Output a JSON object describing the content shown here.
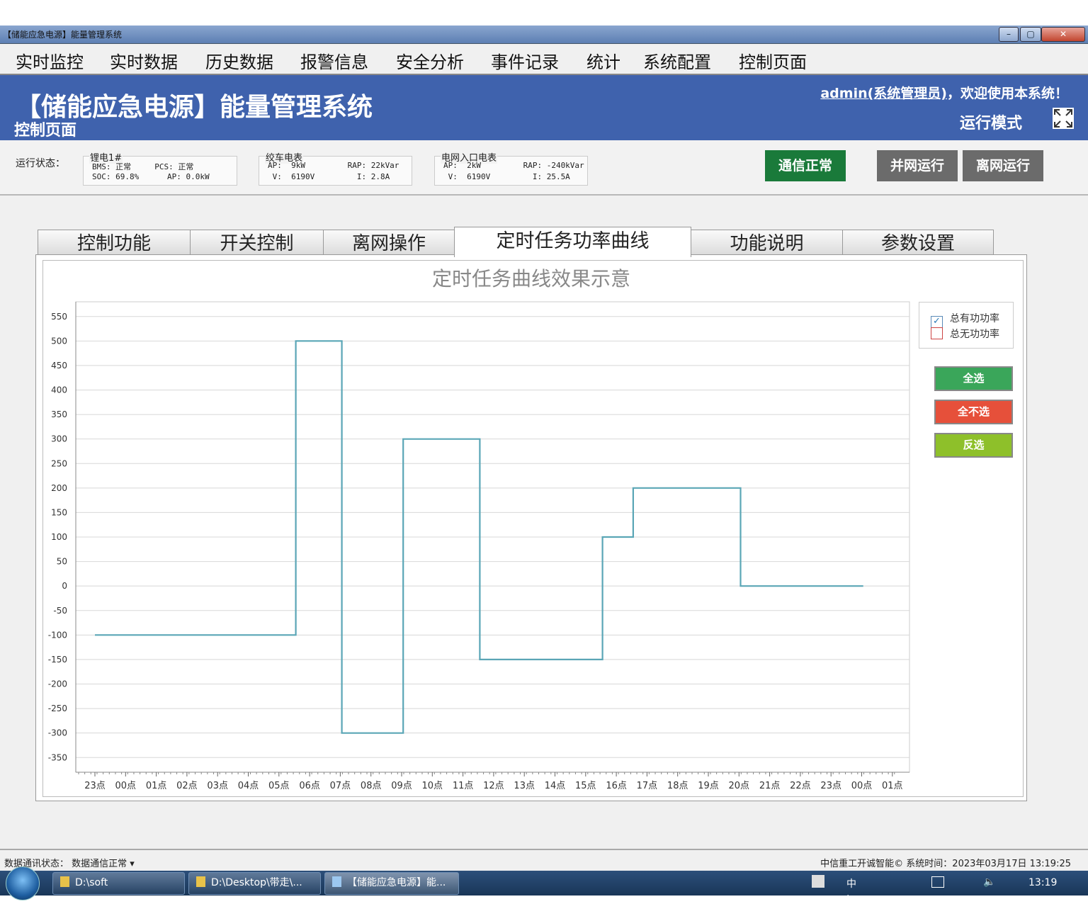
{
  "window": {
    "title": "【储能应急电源】能量管理系统"
  },
  "menu": [
    "实时监控",
    "实时数据",
    "历史数据",
    "报警信息",
    "安全分析",
    "事件记录",
    "统计",
    "系统配置",
    "控制页面"
  ],
  "header": {
    "title": "【储能应急电源】能量管理系统",
    "subtitle": "控制页面",
    "user": "admin(系统管理员)",
    "welcome_suffix": "，欢迎使用本系统！",
    "mode": "运行模式"
  },
  "status": {
    "label": "运行状态：",
    "meters": [
      {
        "title": "锂电1#",
        "line1": "BMS: 正常     PCS: 正常",
        "line2": "SOC: 69.8%      AP: 0.0kW"
      },
      {
        "title": "绞车电表",
        "line1": "AP:  9kW         RAP: 22kVar",
        "line2": " V:  6190V         I: 2.8A"
      },
      {
        "title": "电网入口电表",
        "line1": "AP:  2kW         RAP: -240kVar",
        "line2": " V:  6190V         I: 25.5A"
      }
    ],
    "comm_button": "通信正常",
    "grid_button": "并网运行",
    "offgrid_button": "离网运行"
  },
  "tabs": [
    "控制功能",
    "开关控制",
    "离网操作",
    "定时任务功率曲线",
    "功能说明",
    "参数设置"
  ],
  "active_tab": "定时任务功率曲线",
  "legend": {
    "items": [
      "总有功功率",
      "总无功功率"
    ]
  },
  "side_buttons": {
    "select_all": "全选",
    "select_none": "全不选",
    "invert": "反选"
  },
  "colors": {
    "line": "#5aa6b6",
    "select_all": "#3aa65a",
    "select_none": "#e6503a",
    "invert": "#8ec02a",
    "comm": "#1a7a3a",
    "header": "#3f62ad"
  },
  "chart_data": {
    "type": "line",
    "title": "定时任务曲线效果示意",
    "step": true,
    "x_ticks": [
      "23点",
      "00点",
      "01点",
      "02点",
      "03点",
      "04点",
      "05点",
      "06点",
      "07点",
      "08点",
      "09点",
      "10点",
      "11点",
      "12点",
      "13点",
      "14点",
      "15点",
      "16点",
      "17点",
      "18点",
      "19点",
      "20点",
      "21点",
      "22点",
      "23点",
      "00点",
      "01点"
    ],
    "y_ticks": [
      550,
      500,
      450,
      400,
      350,
      300,
      250,
      200,
      150,
      100,
      50,
      0,
      -50,
      -100,
      -150,
      -200,
      -250,
      -300,
      -350
    ],
    "ylim": [
      -380,
      580
    ],
    "series": [
      {
        "name": "总有功功率",
        "checked": true,
        "points": [
          [
            0,
            -100
          ],
          [
            6.55,
            -100
          ],
          [
            6.55,
            500
          ],
          [
            8.05,
            500
          ],
          [
            8.05,
            -300
          ],
          [
            10.05,
            -300
          ],
          [
            10.05,
            300
          ],
          [
            12.55,
            300
          ],
          [
            12.55,
            -150
          ],
          [
            16.55,
            -150
          ],
          [
            16.55,
            100
          ],
          [
            17.55,
            100
          ],
          [
            17.55,
            200
          ],
          [
            21.05,
            200
          ],
          [
            21.05,
            0
          ],
          [
            25.05,
            0
          ]
        ]
      },
      {
        "name": "总无功功率",
        "checked": false,
        "points": []
      }
    ]
  },
  "statusbar": {
    "left": "数据通讯状态：  数据通信正常  ▾",
    "right": "中信重工开诚智能©  系统时间：2023年03月17日 13:19:25"
  },
  "taskbar": {
    "tasks": [
      "D:\\soft",
      "D:\\Desktop\\带走\\...",
      "【储能应急电源】能..."
    ],
    "tray": "中 ·,",
    "clock": "13:19"
  }
}
